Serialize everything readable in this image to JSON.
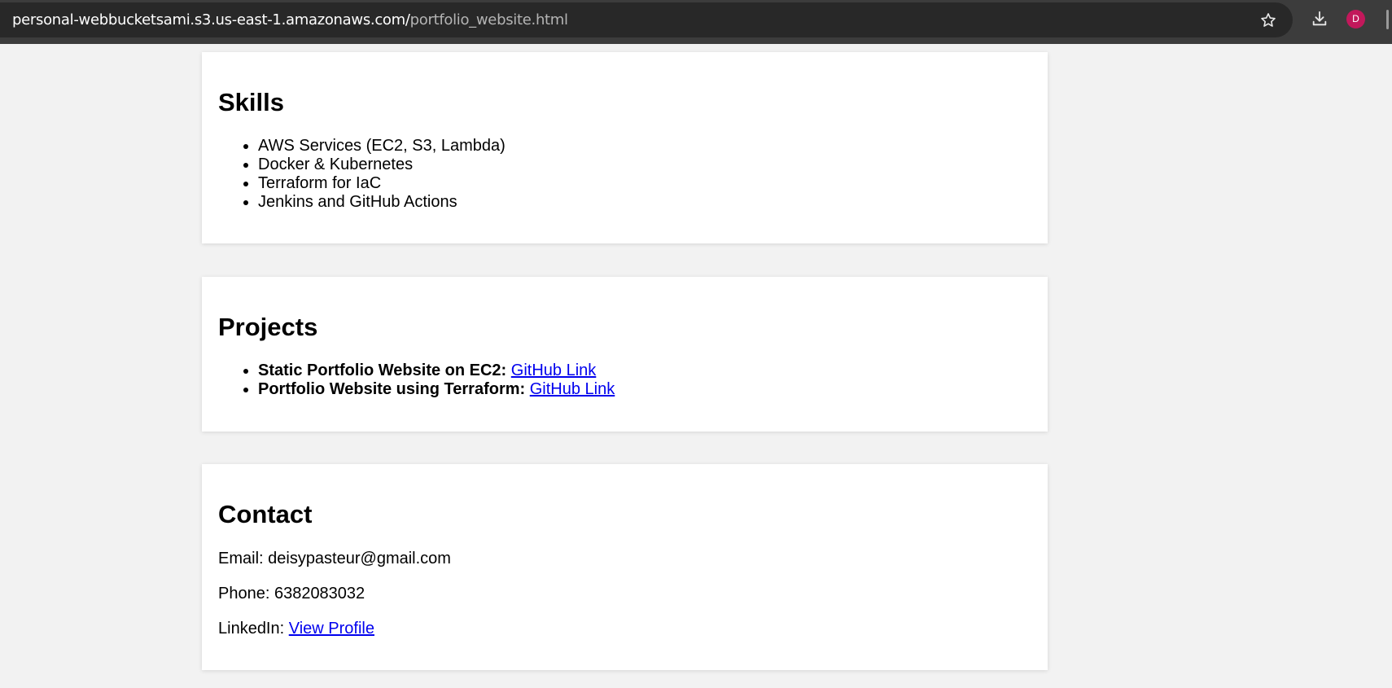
{
  "browser": {
    "url_host": "personal-webbucketsami.s3.us-east-1.amazonaws.com/",
    "url_path": "portfolio_website.html",
    "avatar_initial": "D",
    "avatar_color": "#c2185b"
  },
  "skills": {
    "heading": "Skills",
    "items": [
      "AWS Services (EC2, S3, Lambda)",
      "Docker & Kubernetes",
      "Terraform for IaC",
      "Jenkins and GitHub Actions"
    ]
  },
  "projects": {
    "heading": "Projects",
    "items": [
      {
        "title": "Static Portfolio Website on EC2:",
        "link_text": "GitHub Link"
      },
      {
        "title": "Portfolio Website using Terraform:",
        "link_text": "GitHub Link"
      }
    ]
  },
  "contact": {
    "heading": "Contact",
    "email_line": "Email: deisypasteur@gmail.com",
    "phone_line": "Phone: 6382083032",
    "linkedin_label": "LinkedIn:",
    "linkedin_link_text": "View Profile"
  },
  "colors": {
    "page_background": "#f2f2f2",
    "card_background": "#ffffff",
    "link": "#0000ee"
  }
}
